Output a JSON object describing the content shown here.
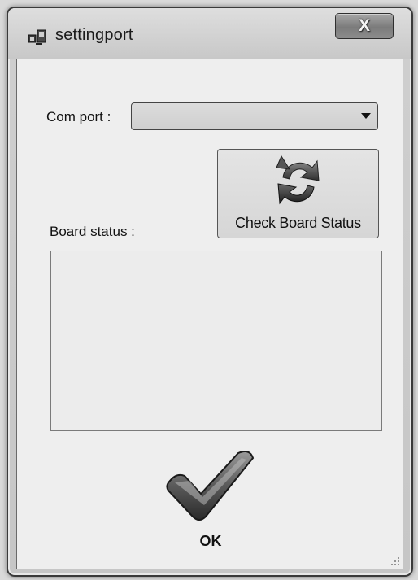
{
  "window": {
    "title": "settingport",
    "close_label": "X"
  },
  "com_port": {
    "label": "Com port :",
    "selected_value": ""
  },
  "check_button": {
    "label": "Check Board Status"
  },
  "board_status": {
    "label": "Board status :",
    "content": ""
  },
  "ok_button": {
    "label": "OK"
  },
  "icons": {
    "app": "app-window-icon",
    "refresh": "refresh-icon",
    "ok": "checkmark-icon",
    "close": "close-icon",
    "dropdown": "chevron-down-icon"
  }
}
